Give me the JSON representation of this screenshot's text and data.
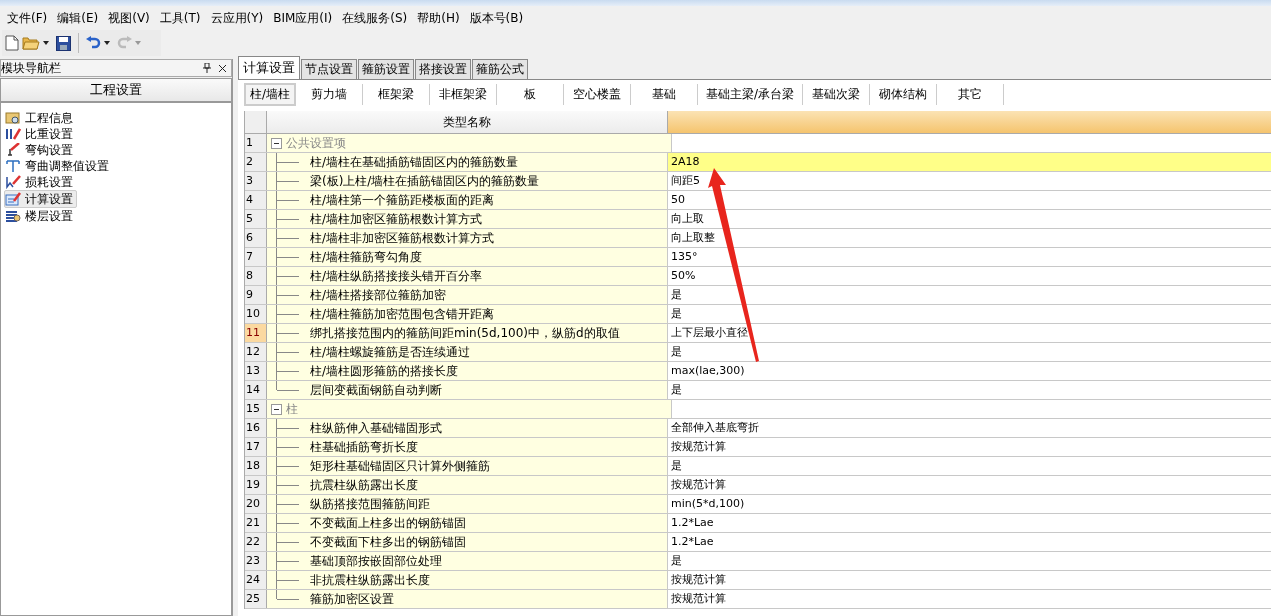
{
  "menu_bar": [
    "文件(F)",
    "编辑(E)",
    "视图(V)",
    "工具(T)",
    "云应用(Y)",
    "BIM应用(I)",
    "在线服务(S)",
    "帮助(H)",
    "版本号(B)"
  ],
  "toolbar": {
    "redo_disabled": true
  },
  "navigator": {
    "title": "模块导航栏",
    "section": "工程设置",
    "items": [
      {
        "label": "工程信息",
        "selected": false
      },
      {
        "label": "比重设置",
        "selected": false
      },
      {
        "label": "弯钩设置",
        "selected": false
      },
      {
        "label": "弯曲调整值设置",
        "selected": false
      },
      {
        "label": "损耗设置",
        "selected": false
      },
      {
        "label": "计算设置",
        "selected": true
      },
      {
        "label": "楼层设置",
        "selected": false
      }
    ]
  },
  "tabs": [
    {
      "label": "计算设置",
      "selected": true
    },
    {
      "label": "节点设置",
      "selected": false
    },
    {
      "label": "箍筋设置",
      "selected": false
    },
    {
      "label": "搭接设置",
      "selected": false
    },
    {
      "label": "箍筋公式",
      "selected": false
    }
  ],
  "subtabs": [
    {
      "label": "柱/墙柱",
      "selected": true
    },
    {
      "label": "剪力墙",
      "selected": false
    },
    {
      "label": "框架梁",
      "selected": false
    },
    {
      "label": "非框架梁",
      "selected": false
    },
    {
      "label": "板",
      "selected": false
    },
    {
      "label": "空心楼盖",
      "selected": false
    },
    {
      "label": "基础",
      "selected": false
    },
    {
      "label": "基础主梁/承台梁",
      "selected": false
    },
    {
      "label": "基础次梁",
      "selected": false
    },
    {
      "label": "砌体结构",
      "selected": false
    },
    {
      "label": "其它",
      "selected": false
    }
  ],
  "table": {
    "columns": [
      "类型名称"
    ],
    "rows": [
      {
        "kind": "group",
        "num": "1",
        "name": "公共设置项",
        "expanded": true,
        "selected": false
      },
      {
        "kind": "item",
        "num": "2",
        "name": "柱/墙柱在基础插筋锚固区内的箍筋数量",
        "value": "2A18",
        "selected": false,
        "value_highlighted": true
      },
      {
        "kind": "item",
        "num": "3",
        "name": "梁(板)上柱/墙柱在插筋锚固区内的箍筋数量",
        "value": "间距5",
        "selected": false,
        "value_highlighted": false
      },
      {
        "kind": "item",
        "num": "4",
        "name": "柱/墙柱第一个箍筋距楼板面的距离",
        "value": "50",
        "selected": false,
        "value_highlighted": false
      },
      {
        "kind": "item",
        "num": "5",
        "name": "柱/墙柱加密区箍筋根数计算方式",
        "value": "向上取",
        "selected": false,
        "value_highlighted": false
      },
      {
        "kind": "item",
        "num": "6",
        "name": "柱/墙柱非加密区箍筋根数计算方式",
        "value": "向上取整",
        "selected": false,
        "value_highlighted": false
      },
      {
        "kind": "item",
        "num": "7",
        "name": "柱/墙柱箍筋弯勾角度",
        "value": "135°",
        "selected": false,
        "value_highlighted": false
      },
      {
        "kind": "item",
        "num": "8",
        "name": "柱/墙柱纵筋搭接接头错开百分率",
        "value": "50%",
        "selected": false,
        "value_highlighted": false
      },
      {
        "kind": "item",
        "num": "9",
        "name": "柱/墙柱搭接部位箍筋加密",
        "value": "是",
        "selected": false,
        "value_highlighted": false
      },
      {
        "kind": "item",
        "num": "10",
        "name": "柱/墙柱箍筋加密范围包含错开距离",
        "value": "是",
        "selected": false,
        "value_highlighted": false
      },
      {
        "kind": "item",
        "num": "11",
        "name": "绑扎搭接范围内的箍筋间距min(5d,100)中，纵筋d的取值",
        "value": "上下层最小直径",
        "selected": true,
        "value_highlighted": false
      },
      {
        "kind": "item",
        "num": "12",
        "name": "柱/墙柱螺旋箍筋是否连续通过",
        "value": "是",
        "selected": false,
        "value_highlighted": false
      },
      {
        "kind": "item",
        "num": "13",
        "name": "柱/墙柱圆形箍筋的搭接长度",
        "value": "max(lae,300)",
        "selected": false,
        "value_highlighted": false
      },
      {
        "kind": "item",
        "num": "14",
        "name": "层间变截面钢筋自动判断",
        "value": "是",
        "selected": false,
        "value_highlighted": false
      },
      {
        "kind": "group",
        "num": "15",
        "name": "柱",
        "expanded": true,
        "selected": false
      },
      {
        "kind": "item",
        "num": "16",
        "name": "柱纵筋伸入基础锚固形式",
        "value": "全部伸入基底弯折",
        "selected": false,
        "value_highlighted": false
      },
      {
        "kind": "item",
        "num": "17",
        "name": "柱基础插筋弯折长度",
        "value": "按规范计算",
        "selected": false,
        "value_highlighted": false
      },
      {
        "kind": "item",
        "num": "18",
        "name": "矩形柱基础锚固区只计算外侧箍筋",
        "value": "是",
        "selected": false,
        "value_highlighted": false
      },
      {
        "kind": "item",
        "num": "19",
        "name": "抗震柱纵筋露出长度",
        "value": "按规范计算",
        "selected": false,
        "value_highlighted": false
      },
      {
        "kind": "item",
        "num": "20",
        "name": "纵筋搭接范围箍筋间距",
        "value": "min(5*d,100)",
        "selected": false,
        "value_highlighted": false
      },
      {
        "kind": "item",
        "num": "21",
        "name": "不变截面上柱多出的钢筋锚固",
        "value": "1.2*Lae",
        "selected": false,
        "value_highlighted": false
      },
      {
        "kind": "item",
        "num": "22",
        "name": "不变截面下柱多出的钢筋锚固",
        "value": "1.2*Lae",
        "selected": false,
        "value_highlighted": false
      },
      {
        "kind": "item",
        "num": "23",
        "name": "基础顶部按嵌固部位处理",
        "value": "是",
        "selected": false,
        "value_highlighted": false
      },
      {
        "kind": "item",
        "num": "24",
        "name": "非抗震柱纵筋露出长度",
        "value": "按规范计算",
        "selected": false,
        "value_highlighted": false
      },
      {
        "kind": "item",
        "num": "25",
        "name": "箍筋加密区设置",
        "value": "按规范计算",
        "selected": false,
        "value_highlighted": false
      }
    ]
  }
}
